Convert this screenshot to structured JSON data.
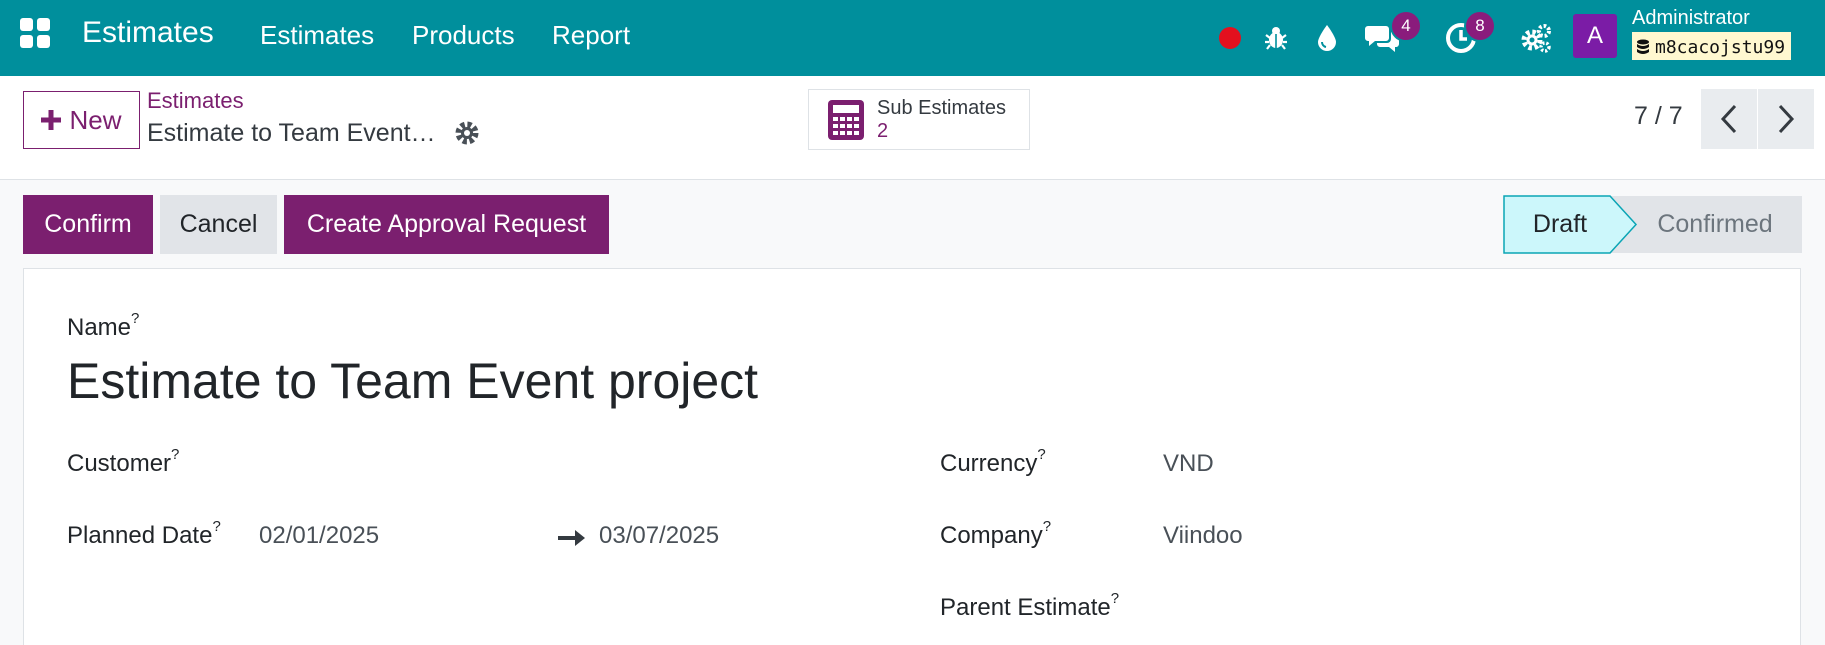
{
  "navbar": {
    "brand": "Estimates",
    "menu": [
      "Estimates",
      "Products",
      "Report"
    ],
    "chat_count": "4",
    "activity_count": "8",
    "avatar_letter": "A",
    "user_name": "Administrator",
    "db_name": "m8cacojstu99",
    "bg_color": "#008f9c"
  },
  "control_panel": {
    "new_label": "New",
    "breadcrumb_parent": "Estimates",
    "breadcrumb_current": "Estimate to Team Event…",
    "smart_button": {
      "label": "Sub Estimates",
      "count": "2",
      "icon": "calculator-icon"
    },
    "pager": "7 / 7"
  },
  "statusbar": {
    "confirm_label": "Confirm",
    "cancel_label": "Cancel",
    "approval_label": "Create Approval Request",
    "stages": [
      "Draft",
      "Confirmed"
    ],
    "active_stage": "Draft"
  },
  "form": {
    "name_label": "Name",
    "name_value": "Estimate to Team Event project",
    "customer_label": "Customer",
    "customer_value": "",
    "planned_date_label": "Planned Date",
    "planned_start": "02/01/2025",
    "planned_end": "03/07/2025",
    "currency_label": "Currency",
    "currency_value": "VND",
    "company_label": "Company",
    "company_value": "Viindoo",
    "parent_label": "Parent Estimate",
    "parent_value": "",
    "help_mark": "?"
  },
  "colors": {
    "primary": "#7b1f6f",
    "accent": "#008f9c",
    "active_stage": "#ccf7fb"
  }
}
